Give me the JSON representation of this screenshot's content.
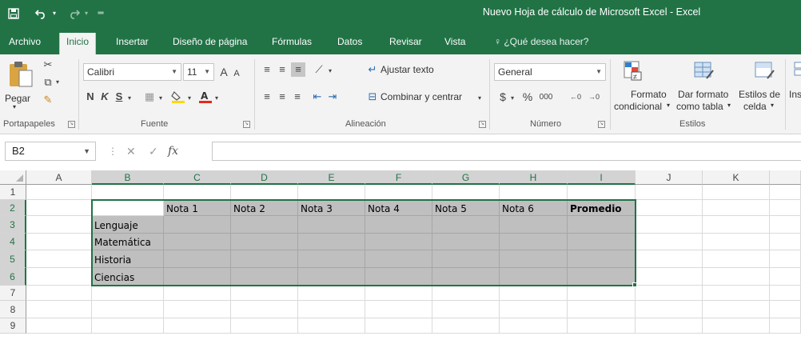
{
  "window": {
    "title": "Nuevo Hoja de cálculo de Microsoft Excel - Excel",
    "accent": "#217346"
  },
  "quick_access": {
    "save_icon": "save-icon",
    "undo_icon": "undo-icon",
    "redo_icon": "redo-icon",
    "customize_icon": "customize-icon"
  },
  "tabs": [
    {
      "label": "Archivo"
    },
    {
      "label": "Inicio"
    },
    {
      "label": "Insertar"
    },
    {
      "label": "Diseño de página"
    },
    {
      "label": "Fórmulas"
    },
    {
      "label": "Datos"
    },
    {
      "label": "Revisar"
    },
    {
      "label": "Vista"
    }
  ],
  "tell_me": "¿Qué desea hacer?",
  "ribbon": {
    "clipboard": {
      "paste_label": "Pegar",
      "group_label": "Portapapeles"
    },
    "font": {
      "font_name": "Calibri",
      "font_size": "11",
      "bold": "N",
      "italic": "K",
      "underline": "S",
      "group_label": "Fuente"
    },
    "alignment": {
      "wrap_text": "Ajustar texto",
      "merge_center": "Combinar y centrar",
      "group_label": "Alineación"
    },
    "number": {
      "format": "General",
      "currency": "$",
      "percent": "%",
      "thousands": "000",
      "group_label": "Número"
    },
    "styles": {
      "conditional_line1": "Formato",
      "conditional_line2": "condicional",
      "table_line1": "Dar formato",
      "table_line2": "como tabla",
      "cell_line1": "Estilos de",
      "cell_line2": "celda",
      "group_label": "Estilos"
    },
    "cells": {
      "insert_partial": "Ins"
    }
  },
  "formula_bar": {
    "name_box": "B2",
    "fx_label": "fx",
    "formula": ""
  },
  "sheet": {
    "columns": [
      "A",
      "B",
      "C",
      "D",
      "E",
      "F",
      "G",
      "H",
      "I",
      "J",
      "K"
    ],
    "rows": [
      "1",
      "2",
      "3",
      "4",
      "5",
      "6",
      "7",
      "8",
      "9"
    ],
    "headers": [
      "",
      "Nota 1",
      "Nota 2",
      "Nota 3",
      "Nota 4",
      "Nota 5",
      "Nota 6",
      "Promedio"
    ],
    "subjects": [
      "Lenguaje",
      "Matemática",
      "Historia",
      "Ciencias"
    ],
    "selected_cell": "B2",
    "selected_range": "B2:I6",
    "range_fill": "#bfbfbf"
  }
}
